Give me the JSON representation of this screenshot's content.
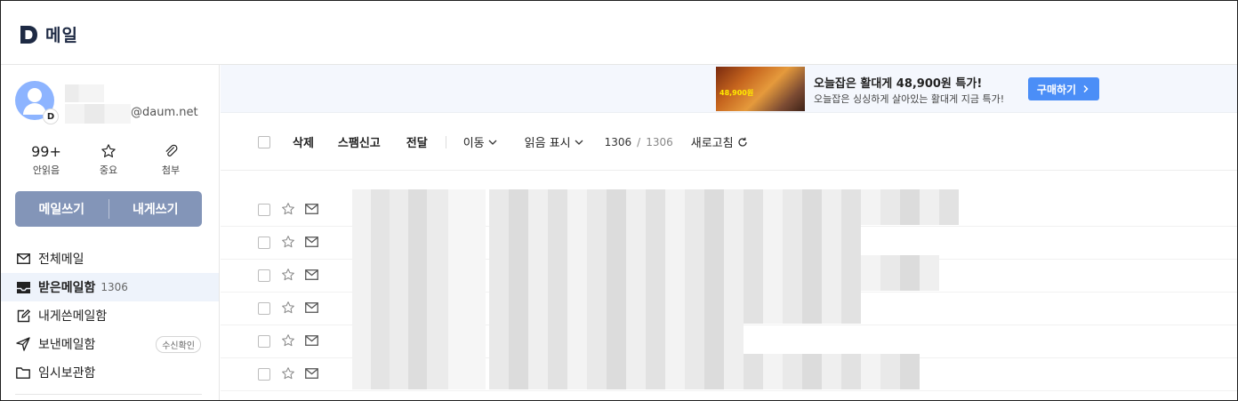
{
  "app": {
    "logo_letter": "D",
    "title": "메일"
  },
  "profile": {
    "badge": "D",
    "email_domain": "@daum.net"
  },
  "stats": [
    {
      "value": "99+",
      "label": "안읽음"
    },
    {
      "icon": "star-icon",
      "label": "중요"
    },
    {
      "icon": "paperclip-icon",
      "label": "첨부"
    }
  ],
  "compose": {
    "write": "메일쓰기",
    "to_me": "내게쓰기"
  },
  "nav": [
    {
      "label": "전체메일",
      "icon": "envelope-icon"
    },
    {
      "label": "받은메일함",
      "count": "1306",
      "icon": "inbox-icon",
      "active": true
    },
    {
      "label": "내게쓴메일함",
      "icon": "memo-icon"
    },
    {
      "label": "보낸메일함",
      "icon": "send-icon",
      "badge": "수신확인"
    },
    {
      "label": "임시보관함",
      "icon": "folder-icon"
    }
  ],
  "ad": {
    "thumb_text": "48,900원",
    "title": "오늘잡은 활대게 48,900원 특가!",
    "subtitle": "오늘잡은 싱싱하게 살아있는 활대게 지금 특가!",
    "button": "구매하기"
  },
  "toolbar": {
    "delete": "삭제",
    "spam": "스팸신고",
    "forward": "전달",
    "move": "이동",
    "mark_read": "읽음 표시",
    "count": "1306",
    "divider": "/",
    "total": "1306",
    "refresh": "새로고침"
  },
  "colors": {
    "accent": "#4b8ef7",
    "compose_bg": "#8395b8",
    "avatar": "#8db4ff",
    "ad_bg": "#f4f7fd"
  },
  "mail_rows": 6
}
